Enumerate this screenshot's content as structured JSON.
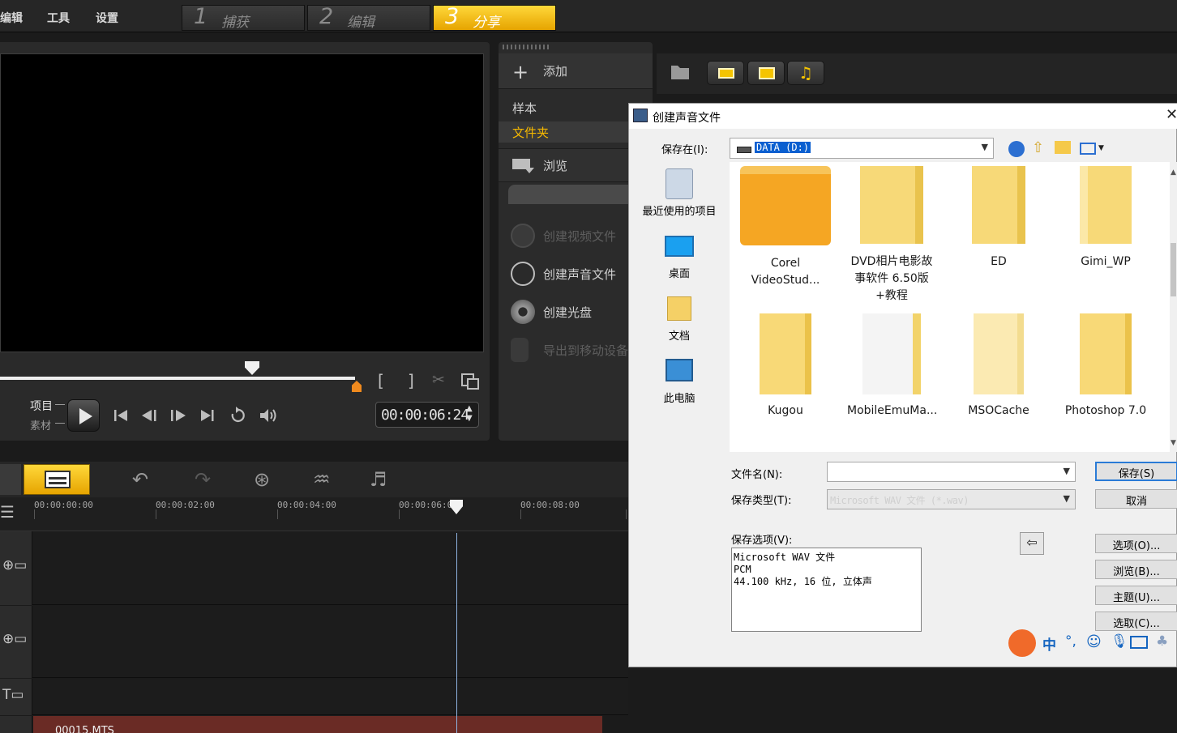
{
  "menu": {
    "edit": "编辑",
    "tools": "工具",
    "settings": "设置"
  },
  "steps": [
    {
      "num": "1",
      "label": "捕获"
    },
    {
      "num": "2",
      "label": "编辑"
    },
    {
      "num": "3",
      "label": "分享"
    }
  ],
  "preview": {
    "mode_project": "项目",
    "mode_clip": "素材",
    "timecode": "00:00:06:24",
    "mark_in": "[",
    "mark_out": "]"
  },
  "share_panel": {
    "add": "添加",
    "sample": "样本",
    "folder": "文件夹",
    "browse": "浏览",
    "items": [
      {
        "label": "创建视频文件"
      },
      {
        "label": "创建声音文件"
      },
      {
        "label": "创建光盘"
      },
      {
        "label": "导出到移动设备"
      }
    ]
  },
  "timeline": {
    "ticks": [
      "00:00:00:00",
      "00:00:02:00",
      "00:00:04:00",
      "00:00:06:00",
      "00:00:08:00"
    ],
    "clip_label": "00015.MTS"
  },
  "dialog": {
    "title": "创建声音文件",
    "save_in_label": "保存在(I):",
    "save_in_value": "DATA (D:)",
    "places": [
      {
        "label": "最近使用的项目"
      },
      {
        "label": "桌面"
      },
      {
        "label": "文档"
      },
      {
        "label": "此电脑"
      }
    ],
    "files": [
      {
        "name": "Corel VideoStud..."
      },
      {
        "name": "DVD相片电影故事软件 6.50版+教程"
      },
      {
        "name": "ED"
      },
      {
        "name": "Gimi_WP"
      },
      {
        "name": "Kugou"
      },
      {
        "name": "MobileEmuMa..."
      },
      {
        "name": "MSOCache"
      },
      {
        "name": "Photoshop 7.0"
      }
    ],
    "filename_label": "文件名(N):",
    "filename_value": "",
    "filetype_label": "保存类型(T):",
    "filetype_value": "Microsoft WAV 文件 (*.wav)",
    "options_label": "保存选项(V):",
    "options_text": "Microsoft WAV 文件\nPCM\n44.100 kHz, 16 位, 立体声",
    "buttons": {
      "save": "保存(S)",
      "cancel": "取消",
      "options": "选项(O)...",
      "browse": "浏览(B)...",
      "theme": "主题(U)...",
      "select": "选取(C)..."
    }
  },
  "ime": {
    "mode": "中"
  },
  "colors": {
    "accent": "#f5b800",
    "dialog_bg": "#f0f0f0",
    "folder": "#f7d466",
    "clip": "#6a2b25"
  }
}
